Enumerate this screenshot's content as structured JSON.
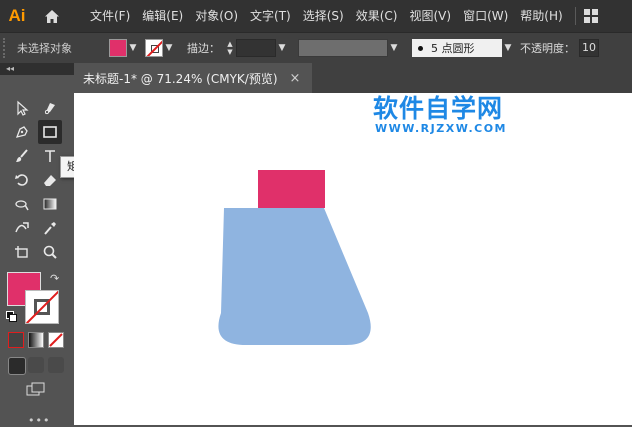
{
  "app": {
    "logo": "Ai"
  },
  "menu": [
    "文件(F)",
    "编辑(E)",
    "对象(O)",
    "文字(T)",
    "选择(S)",
    "效果(C)",
    "视图(V)",
    "窗口(W)",
    "帮助(H)"
  ],
  "control_bar": {
    "selection_status": "未选择对象",
    "fill_color": "#e0306a",
    "stroke_label": "描边：",
    "brush_label": "5 点圆形",
    "opacity_label": "不透明度：",
    "opacity_value": "10"
  },
  "document_tab": {
    "title": "未标题-1* @ 71.24% (CMYK/预览)",
    "close": "×"
  },
  "toolbar": {
    "collapse": "◂◂",
    "tools": [
      "selection-tool",
      "direct-selection-tool",
      "pen-tool",
      "curvature-tool",
      "rectangle-tool",
      "paintbrush-tool",
      "type-tool",
      "rotate-tool",
      "eraser-tool",
      "width-tool",
      "gradient-tool",
      "free-transform-tool",
      "eyedropper-tool",
      "blend-tool",
      "zoom-tool",
      "artboard-tool"
    ],
    "more": "•••"
  },
  "tooltip": {
    "text": "矩形工具 (M)"
  },
  "colors": {
    "fill": "#e0306a",
    "flask_body": "#8fb4e0",
    "flask_cap": "#e0306a",
    "accent": "#ff9a00",
    "watermark": "#1e88e5"
  },
  "watermark": {
    "title": "软件自学网",
    "url": "WWW.RJZXW.COM"
  }
}
